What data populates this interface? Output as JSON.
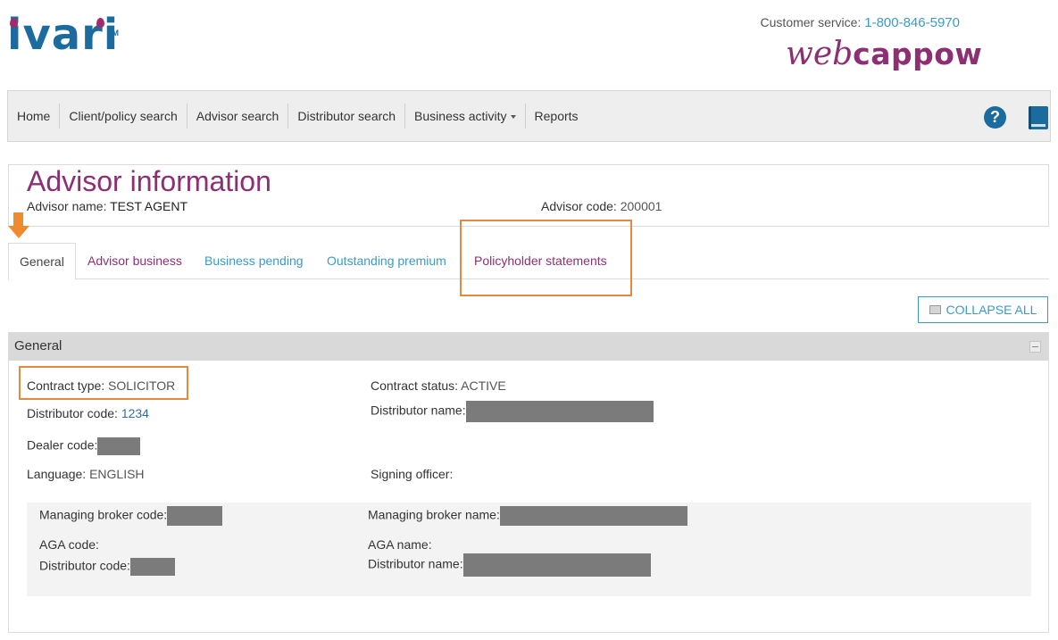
{
  "header": {
    "logo_text": "ivari",
    "logo_tm": "TM",
    "customer_service_label": "Customer service:",
    "customer_service_phone": "1-800-846-5970",
    "brand_web": "web",
    "brand_cappow": "cappow"
  },
  "nav": {
    "items": [
      "Home",
      "Client/policy search",
      "Advisor search",
      "Distributor search",
      "Business activity",
      "Reports"
    ]
  },
  "advisor": {
    "page_title": "Advisor information",
    "name_label": "Advisor name:",
    "name_value": "TEST AGENT",
    "code_label": "Advisor code:",
    "code_value": "200001"
  },
  "tabs": [
    "General",
    "Advisor business",
    "Business pending",
    "Outstanding premium",
    "Policyholder statements"
  ],
  "collapse_all_label": "COLLAPSE ALL",
  "section": {
    "title": "General",
    "contract_type_label": "Contract type:",
    "contract_type_value": "SOLICITOR",
    "contract_status_label": "Contract status:",
    "contract_status_value": "ACTIVE",
    "distributor_code_label": "Distributor code:",
    "distributor_code_value": "1234",
    "distributor_name_label": "Distributor name:",
    "dealer_code_label": "Dealer code:",
    "language_label": "Language:",
    "language_value": "ENGLISH",
    "signing_officer_label": "Signing officer:"
  },
  "broker": {
    "managing_broker_code_label": "Managing broker code:",
    "managing_broker_name_label": "Managing broker name:",
    "aga_code_label": "AGA code:",
    "aga_name_label": "AGA name:",
    "distributor_code_label": "Distributor code:",
    "distributor_name_label": "Distributor name:"
  },
  "colors": {
    "brand_purple": "#8d2f73",
    "brand_blue": "#1c6b9e",
    "link_blue": "#3a9bc6",
    "highlight_orange": "#e38a3e"
  },
  "icons": [
    "help-icon",
    "book-icon",
    "arrow-down-icon",
    "collapse-icon",
    "section-toggle-icon"
  ]
}
